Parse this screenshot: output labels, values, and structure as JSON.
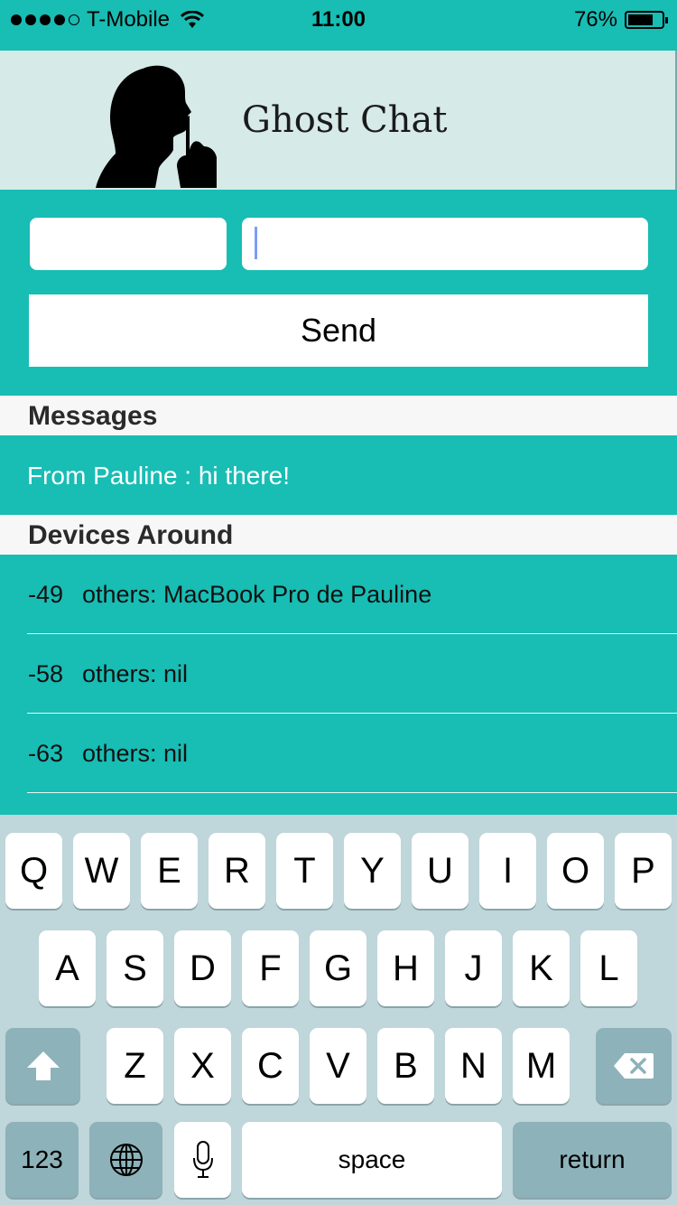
{
  "status_bar": {
    "carrier": "T-Mobile",
    "time": "11:00",
    "battery_percent": "76%",
    "battery_level": 0.76,
    "signal_dots": [
      true,
      true,
      true,
      true,
      false
    ]
  },
  "header": {
    "title": "Ghost Chat"
  },
  "compose": {
    "name_value": "",
    "message_value": "",
    "send_label": "Send"
  },
  "messages": {
    "header": "Messages",
    "items": [
      {
        "text": "From Pauline : hi there!"
      }
    ]
  },
  "devices": {
    "header": "Devices Around",
    "items": [
      {
        "rssi": "-49",
        "label": "others: MacBook Pro de Pauline"
      },
      {
        "rssi": "-58",
        "label": "others: nil"
      },
      {
        "rssi": "-63",
        "label": "others: nil"
      }
    ]
  },
  "keyboard": {
    "row1": [
      "Q",
      "W",
      "E",
      "R",
      "T",
      "Y",
      "U",
      "I",
      "O",
      "P"
    ],
    "row2": [
      "A",
      "S",
      "D",
      "F",
      "G",
      "H",
      "J",
      "K",
      "L"
    ],
    "row3": [
      "Z",
      "X",
      "C",
      "V",
      "B",
      "N",
      "M"
    ],
    "numbers_label": "123",
    "space_label": "space",
    "return_label": "return",
    "icons": [
      "shift-icon",
      "delete-icon",
      "globe-icon",
      "microphone-icon"
    ]
  },
  "colors": {
    "teal": "#18bdb4",
    "header_bg": "#d6eae8",
    "section_bg": "#f7f7f7",
    "keyboard_bg": "#bfd6da",
    "caret": "#7f9cf5"
  }
}
